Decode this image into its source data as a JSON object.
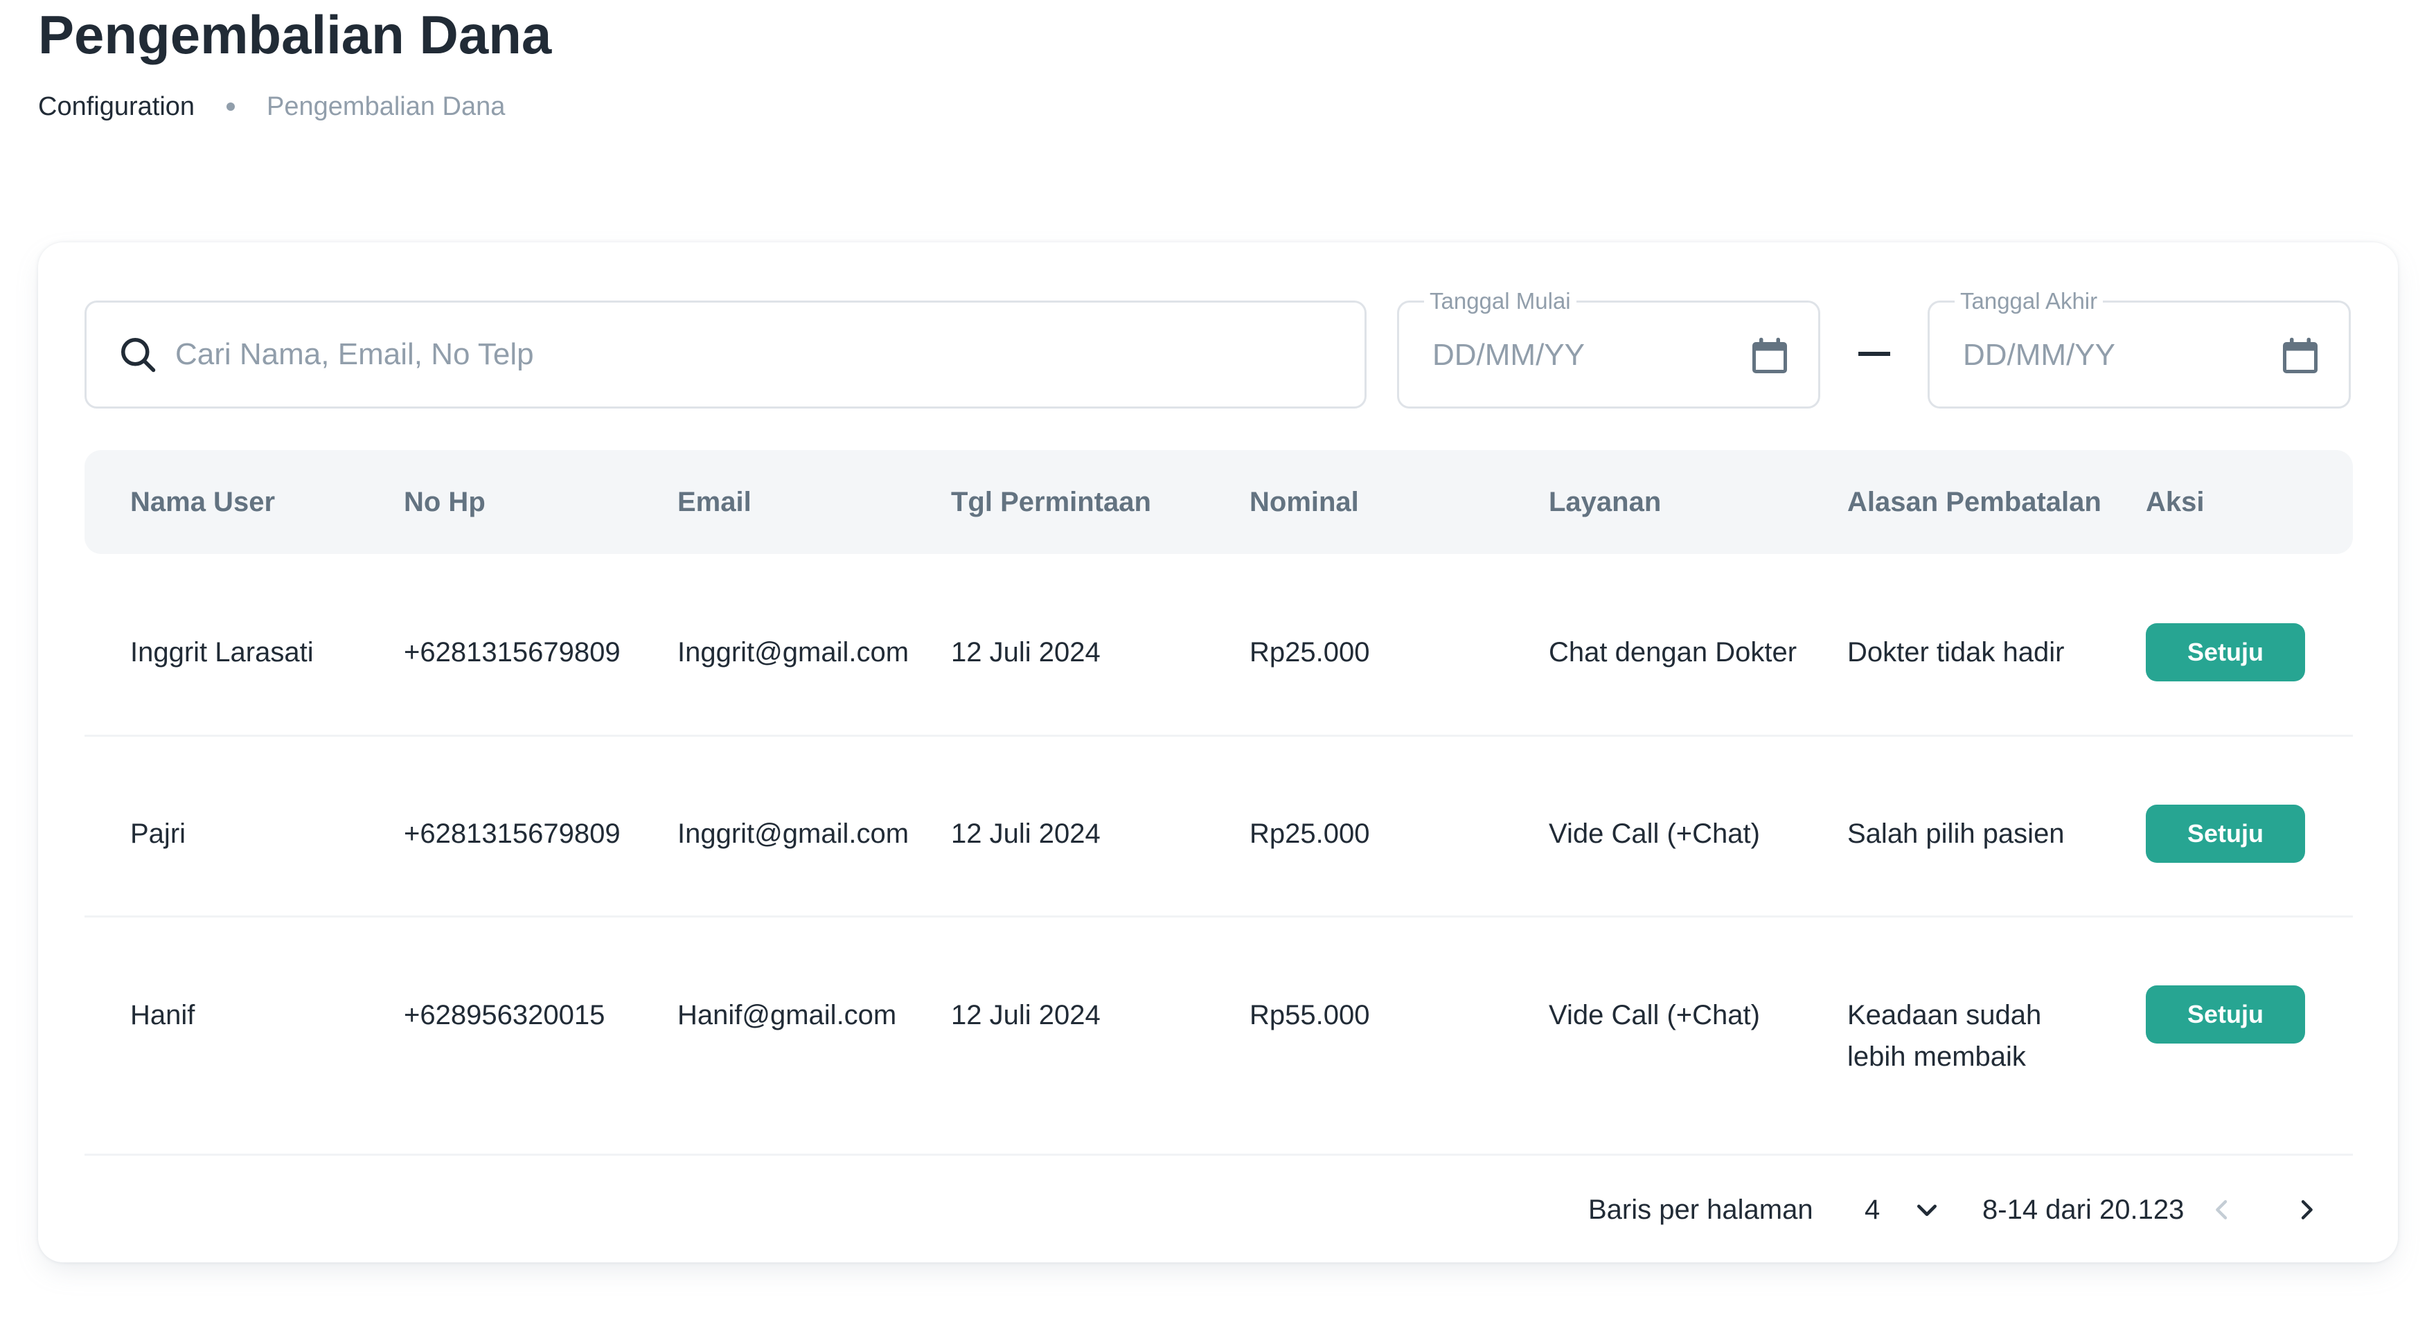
{
  "page": {
    "title": "Pengembalian Dana",
    "breadcrumb": {
      "first": "Configuration",
      "current": "Pengembalian Dana"
    }
  },
  "filters": {
    "search_placeholder": "Cari Nama, Email, No Telp",
    "start_date": {
      "label": "Tanggal Mulai",
      "placeholder": "DD/MM/YY"
    },
    "end_date": {
      "label": "Tanggal Akhir",
      "placeholder": "DD/MM/YY"
    }
  },
  "table": {
    "columns": [
      "Nama User",
      "No Hp",
      "Email",
      "Tgl Permintaan",
      "Nominal",
      "Layanan",
      "Alasan Pembatalan",
      "Aksi"
    ],
    "rows": [
      {
        "name": "Inggrit Larasati",
        "phone": "+6281315679809",
        "email": "Inggrit@gmail.com",
        "date": "12 Juli 2024",
        "amount": "Rp25.000",
        "service": "Chat dengan Dokter",
        "reason": "Dokter tidak hadir",
        "action": "Setuju"
      },
      {
        "name": "Pajri",
        "phone": "+6281315679809",
        "email": "Inggrit@gmail.com",
        "date": "12 Juli 2024",
        "amount": "Rp25.000",
        "service": "Vide Call (+Chat)",
        "reason": "Salah pilih pasien",
        "action": "Setuju"
      },
      {
        "name": "Hanif",
        "phone": "+628956320015",
        "email": "Hanif@gmail.com",
        "date": "12 Juli 2024",
        "amount": "Rp55.000",
        "service": "Vide Call (+Chat)",
        "reason": "Keadaan sudah",
        "reason_line2": "lebih membaik",
        "action": "Setuju"
      }
    ]
  },
  "pagination": {
    "rows_per_page_label": "Baris per halaman",
    "rows_per_page_value": "4",
    "range_text": "8-14 dari 20.123"
  },
  "colors": {
    "accent": "#27A592",
    "text": "#212B36",
    "muted": "#919EAB",
    "header_bg": "#F4F6F8"
  }
}
